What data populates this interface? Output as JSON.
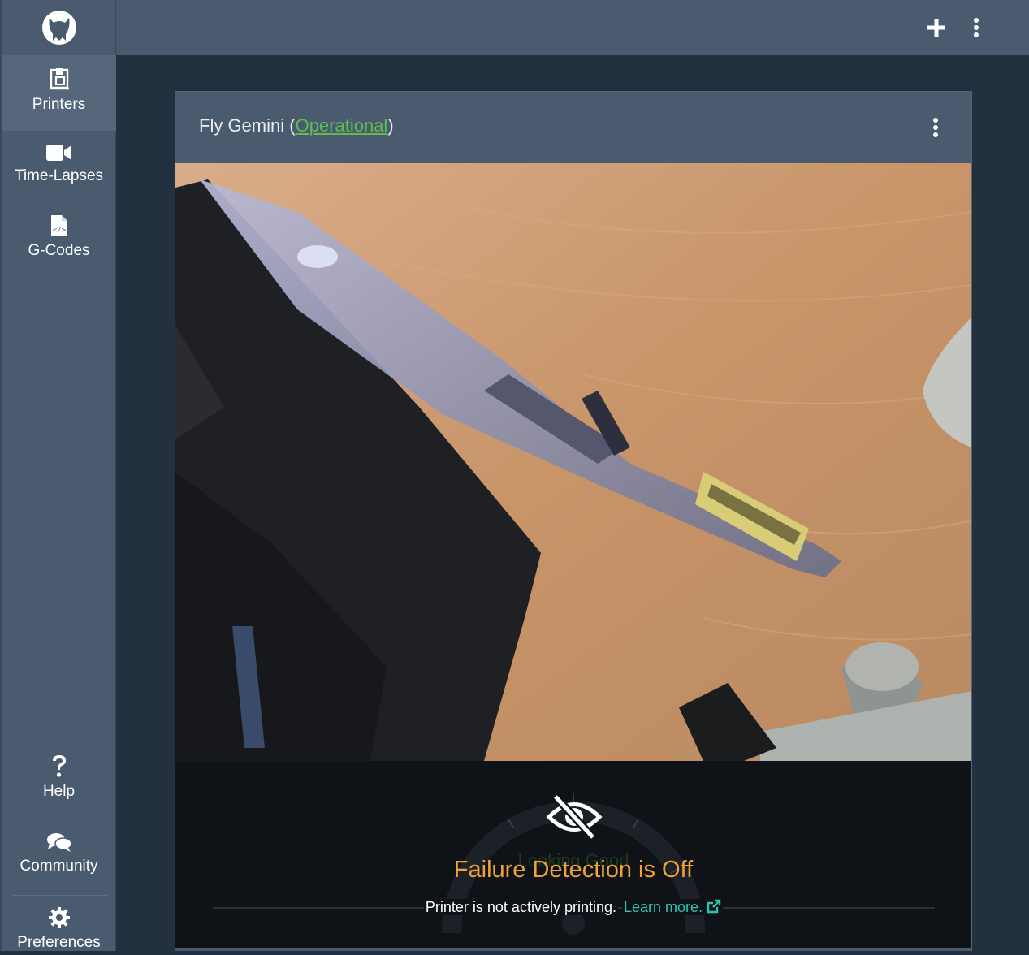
{
  "sidebar": {
    "items": [
      {
        "label": "Printers",
        "icon": "printer-icon",
        "active": true
      },
      {
        "label": "Time-Lapses",
        "icon": "video-camera-icon"
      },
      {
        "label": "G-Codes",
        "icon": "code-file-icon"
      }
    ],
    "bottom_items": [
      {
        "label": "Help",
        "icon": "question-icon"
      },
      {
        "label": "Community",
        "icon": "comments-icon"
      },
      {
        "label": "Preferences",
        "icon": "gear-icon"
      }
    ]
  },
  "topbar": {
    "add_icon": "plus-icon",
    "menu_icon": "vertical-ellipsis-icon"
  },
  "printer_card": {
    "name": "Fly Gemini",
    "status": "Operational",
    "status_color": "#5fbd4e",
    "gauge_label": "Looking Good",
    "failure_detection_title": "Failure Detection is Off",
    "failure_detection_message": "Printer is not actively printing.",
    "learn_more": "Learn more.",
    "title_color": "#f0a23a",
    "link_color": "#2fc3b1"
  }
}
